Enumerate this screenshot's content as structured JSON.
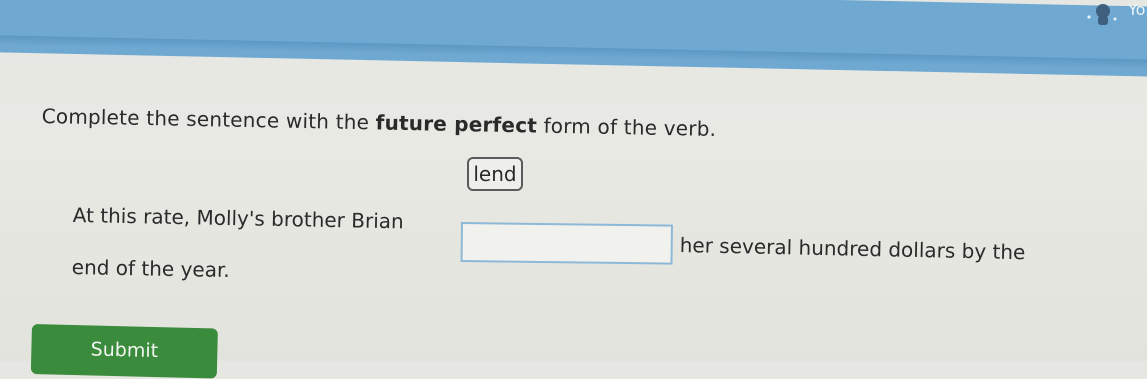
{
  "header": {
    "user_initial": "Yo",
    "avatar_icon": "user-avatar-icon",
    "bar_color": "#6fa9d2"
  },
  "question": {
    "instruction_prefix": "Complete the sentence with the ",
    "instruction_bold": "future perfect",
    "instruction_suffix": " form of the verb.",
    "verb": "lend",
    "sentence_before_blank": "At this rate, Molly's brother Brian",
    "sentence_after_blank": "her several hundred dollars by the",
    "sentence_end": "end of the year.",
    "answer_value": ""
  },
  "actions": {
    "submit_label": "Submit",
    "submit_color": "#3b8b3c"
  }
}
